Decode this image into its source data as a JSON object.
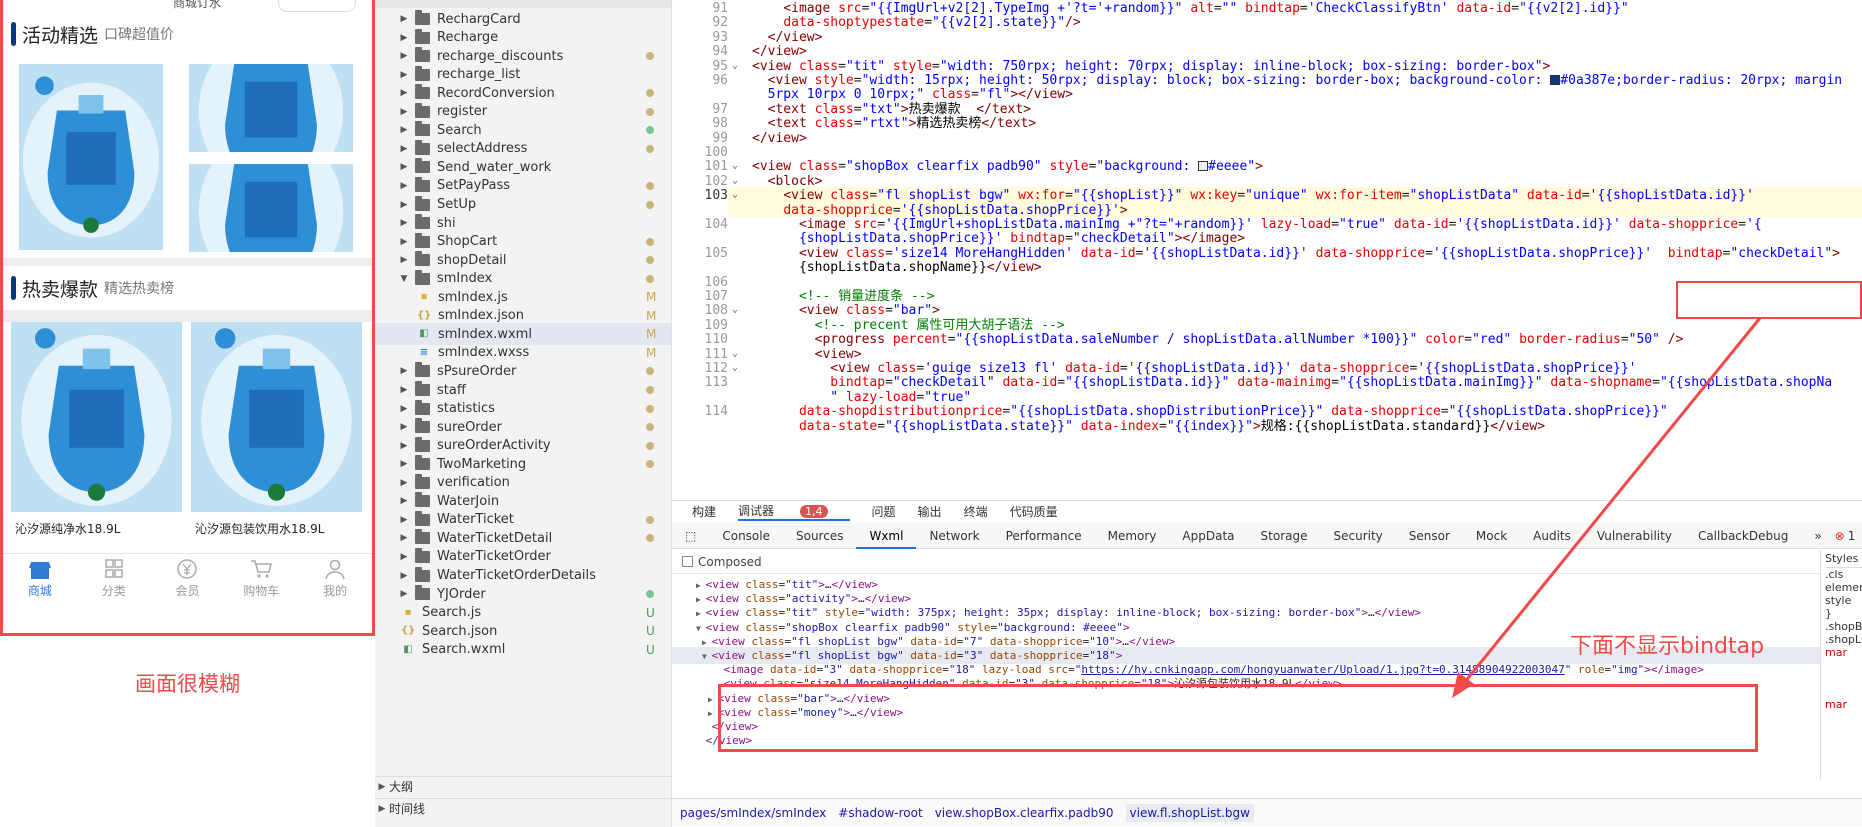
{
  "phone": {
    "top_title": "商城订水",
    "section1": {
      "title": "活动精选",
      "subtitle": "口碑超值价"
    },
    "section2": {
      "title": "热卖爆款",
      "subtitle": "精选热卖榜"
    },
    "hot_items": [
      {
        "name": "沁汐源纯净水18.9L"
      },
      {
        "name": "沁汐源包装饮用水18.9L"
      }
    ],
    "tabs": [
      "商城",
      "分类",
      "会员",
      "购物车",
      "我的"
    ],
    "active_tab": "商城",
    "accent": "#0a387e",
    "tab_active_color": "#2e7cd6"
  },
  "annotations": {
    "blurry_note": "画面很模糊",
    "bindtap_note": "下面不显示bindtap",
    "color": "#f24949"
  },
  "explorer": {
    "items": [
      {
        "name": "RechargCard",
        "kind": "folder",
        "expanded": false,
        "status": ""
      },
      {
        "name": "Recharge",
        "kind": "folder",
        "expanded": false,
        "status": ""
      },
      {
        "name": "recharge_discounts",
        "kind": "folder",
        "expanded": false,
        "status": "dot"
      },
      {
        "name": "recharge_list",
        "kind": "folder",
        "expanded": false,
        "status": ""
      },
      {
        "name": "RecordConversion",
        "kind": "folder",
        "expanded": false,
        "status": "dot"
      },
      {
        "name": "register",
        "kind": "folder",
        "expanded": false,
        "status": "dot"
      },
      {
        "name": "Search",
        "kind": "folder",
        "expanded": false,
        "status": "dot-green"
      },
      {
        "name": "selectAddress",
        "kind": "folder",
        "expanded": false,
        "status": "dot"
      },
      {
        "name": "Send_water_work",
        "kind": "folder",
        "expanded": false,
        "status": ""
      },
      {
        "name": "SetPayPass",
        "kind": "folder",
        "expanded": false,
        "status": "dot"
      },
      {
        "name": "SetUp",
        "kind": "folder",
        "expanded": false,
        "status": "dot"
      },
      {
        "name": "shi",
        "kind": "folder",
        "expanded": false,
        "status": ""
      },
      {
        "name": "ShopCart",
        "kind": "folder",
        "expanded": false,
        "status": "dot"
      },
      {
        "name": "shopDetail",
        "kind": "folder",
        "expanded": false,
        "status": "dot"
      },
      {
        "name": "smIndex",
        "kind": "folder",
        "expanded": true,
        "status": "dot"
      },
      {
        "name": "smIndex.js",
        "kind": "js",
        "status": "M",
        "indent": 1
      },
      {
        "name": "smIndex.json",
        "kind": "json",
        "status": "M",
        "indent": 1
      },
      {
        "name": "smIndex.wxml",
        "kind": "wxml",
        "status": "M",
        "indent": 1,
        "selected": true
      },
      {
        "name": "smIndex.wxss",
        "kind": "wxss",
        "status": "M",
        "indent": 1
      },
      {
        "name": "sPsureOrder",
        "kind": "folder",
        "expanded": false,
        "status": "dot"
      },
      {
        "name": "staff",
        "kind": "folder",
        "expanded": false,
        "status": "dot"
      },
      {
        "name": "statistics",
        "kind": "folder",
        "expanded": false,
        "status": "dot"
      },
      {
        "name": "sureOrder",
        "kind": "folder",
        "expanded": false,
        "status": "dot"
      },
      {
        "name": "sureOrderActivity",
        "kind": "folder",
        "expanded": false,
        "status": "dot"
      },
      {
        "name": "TwoMarketing",
        "kind": "folder",
        "expanded": false,
        "status": "dot"
      },
      {
        "name": "verification",
        "kind": "folder",
        "expanded": false,
        "status": ""
      },
      {
        "name": "WaterJoin",
        "kind": "folder",
        "expanded": false,
        "status": ""
      },
      {
        "name": "WaterTicket",
        "kind": "folder",
        "expanded": false,
        "status": "dot"
      },
      {
        "name": "WaterTicketDetail",
        "kind": "folder",
        "expanded": false,
        "status": "dot"
      },
      {
        "name": "WaterTicketOrder",
        "kind": "folder",
        "expanded": false,
        "status": ""
      },
      {
        "name": "WaterTicketOrderDetails",
        "kind": "folder",
        "expanded": false,
        "status": ""
      },
      {
        "name": "YJOrder",
        "kind": "folder",
        "expanded": false,
        "status": "dot-green"
      },
      {
        "name": "Search.js",
        "kind": "js",
        "status": "U",
        "indent": 0
      },
      {
        "name": "Search.json",
        "kind": "json",
        "status": "U",
        "indent": 0
      },
      {
        "name": "Search.wxml",
        "kind": "wxml",
        "status": "U",
        "indent": 0
      }
    ],
    "outline": "大纲",
    "timeline": "时间线"
  },
  "editor": {
    "lines": [
      {
        "n": "91",
        "html": "    <span class='tag'>&lt;image</span> <span class='at'>src</span>=<span class='st'>\"{{ImgUrl+v2[2].TypeImg +'?t='+random}}\"</span> <span class='at'>alt</span>=<span class='st'>\"\"</span> <span class='at'>bindtap</span>=<span class='st'>'CheckClassifyBtn'</span> <span class='at'>data-id</span>=<span class='st'>\"{{v2[2].id}}\"</span>"
      },
      {
        "n": "92",
        "html": "    <span class='at'>data-shoptypestate</span>=<span class='st'>\"{{v2[2].state}}\"</span><span class='tag'>/&gt;</span>"
      },
      {
        "n": "93",
        "html": "  <span class='tag'>&lt;/view&gt;</span>"
      },
      {
        "n": "94",
        "html": "<span class='tag'>&lt;/view&gt;</span>"
      },
      {
        "n": "95",
        "html": "<span class='tag'>&lt;view</span> <span class='at'>class</span>=<span class='st'>\"tit\"</span> <span class='at'>style</span>=<span class='st'>\"width: 750rpx; height: 70rpx; display: inline-block; box-sizing: border-box\"</span><span class='tag'>&gt;</span>"
      },
      {
        "n": "96",
        "html": "  <span class='tag'>&lt;view</span> <span class='at'>style</span>=<span class='st'>\"width: 15rpx; height: 50rpx; display: block; box-sizing: border-box; background-color: <span class='csw' style='background:#0a387e'></span>#0a387e;border-radius: 20rpx; margin</span>"
      },
      {
        "n": "",
        "html": "  <span class='st'>5rpx 10rpx 0 10rpx;\"</span> <span class='at'>class</span>=<span class='st'>\"fl\"</span><span class='tag'>&gt;&lt;/view&gt;</span>"
      },
      {
        "n": "97",
        "html": "  <span class='tag'>&lt;text</span> <span class='at'>class</span>=<span class='st'>\"txt\"</span><span class='tag'>&gt;</span><span class='tx'>热卖爆款  </span><span class='tag'>&lt;/text&gt;</span>"
      },
      {
        "n": "98",
        "html": "  <span class='tag'>&lt;text</span> <span class='at'>class</span>=<span class='st'>\"rtxt\"</span><span class='tag'>&gt;</span><span class='tx'>精选热卖榜</span><span class='tag'>&lt;/text&gt;</span>"
      },
      {
        "n": "99",
        "html": "<span class='tag'>&lt;/view&gt;</span>"
      },
      {
        "n": "100",
        "html": ""
      },
      {
        "n": "101",
        "html": "<span class='tag'>&lt;view</span> <span class='at'>class</span>=<span class='st'>\"shopBox clearfix padb90\"</span> <span class='at'>style</span>=<span class='st'>\"background: <span class='csw' style='background:#eeeeee'></span>#eeee\"</span><span class='tag'>&gt;</span>"
      },
      {
        "n": "102",
        "html": "  <span class='tag'>&lt;block&gt;</span>"
      },
      {
        "n": "103",
        "html": "    <span class='tag'>&lt;view</span> <span class='at'>class</span>=<span class='st'>\"fl shopList bgw\"</span> <span class='at'>wx:for</span>=<span class='st'>\"{{shopList}}\"</span> <span class='at'>wx:key</span>=<span class='st'>\"unique\"</span> <span class='at'>wx:for-item</span>=<span class='st'>\"shopListData\"</span> <span class='at'>data-id</span>=<span class='st'>'{{shopListData.id}}'</span>"
      },
      {
        "n": "",
        "html": "    <span class='at'>data-shopprice</span>=<span class='st'>'{{shopListData.shopPrice}}'</span><span class='tag'>&gt;</span>"
      },
      {
        "n": "104",
        "html": "      <span class='tag'>&lt;image</span> <span class='at'>src</span>=<span class='st'>'{{ImgUrl+shopListData.mainImg +\"?t=\"+random}}'</span> <span class='at'>lazy-load</span>=<span class='st'>\"true\"</span> <span class='at'>data-id</span>=<span class='st'>'{{shopListData.id}}'</span> <span class='at'>data-shopprice</span>=<span class='st'>'{</span>"
      },
      {
        "n": "",
        "html": "      <span class='st'>{shopListData.shopPrice}}'</span> <span class='at'>bindtap</span>=<span class='st'>\"checkDetail\"</span><span class='tag'>&gt;&lt;/image&gt;</span>"
      },
      {
        "n": "105",
        "html": "      <span class='tag'>&lt;view</span> <span class='at'>class</span>=<span class='st'>'size14 MoreHangHidden'</span> <span class='at'>data-id</span>=<span class='st'>'{{shopListData.id}}'</span> <span class='at'>data-shopprice</span>=<span class='st'>'{{shopListData.shopPrice}}'</span>  <span class='at'>bindtap</span>=<span class='st'>\"checkDetail\"</span><span class='tag'>&gt;</span>"
      },
      {
        "n": "",
        "html": "      <span class='tx'>{shopListData.shopName}}</span><span class='tag'>&lt;/view&gt;</span>"
      },
      {
        "n": "106",
        "html": ""
      },
      {
        "n": "107",
        "html": "      <span class='cm'>&lt;!-- 销量进度条 --&gt;</span>"
      },
      {
        "n": "108",
        "html": "      <span class='tag'>&lt;view</span> <span class='at'>class</span>=<span class='st'>\"bar\"</span><span class='tag'>&gt;</span>"
      },
      {
        "n": "109",
        "html": "        <span class='cm'>&lt;!-- precent 属性可用大胡子语法 --&gt;</span>"
      },
      {
        "n": "110",
        "html": "        <span class='tag'>&lt;progress</span> <span class='at'>percent</span>=<span class='st'>\"{{shopListData.saleNumber / shopListData.allNumber *100}}\"</span> <span class='at'>color</span>=<span class='st'>\"red\"</span> <span class='at'>border-radius</span>=<span class='st'>\"50\"</span> <span class='tag'>/&gt;</span>"
      },
      {
        "n": "111",
        "html": "        <span class='tag'>&lt;view&gt;</span>"
      },
      {
        "n": "112",
        "html": "          <span class='tag'>&lt;view</span> <span class='at'>class</span>=<span class='st'>'guige size13 fl'</span> <span class='at'>data-id</span>=<span class='st'>'{{shopListData.id}}'</span> <span class='at'>data-shopprice</span>=<span class='st'>'{{shopListData.shopPrice}}'</span>"
      },
      {
        "n": "113",
        "html": "          <span class='at'>bindtap</span>=<span class='st'>\"checkDetail\"</span> <span class='at'>data-id</span>=<span class='st'>\"{{shopListData.id}}\"</span> <span class='at'>data-mainimg</span>=<span class='st'>\"{{shopListData.mainImg}}\"</span> <span class='at'>data-shopname</span>=<span class='st'>\"{{shopListData.shopNa</span>"
      },
      {
        "n": "",
        "html": "          <span class='st'>\"</span> <span class='at'>lazy-load</span>=<span class='st'>\"true\"</span>"
      },
      {
        "n": "114",
        "html": "      <span class='at'>data-shopdistributionprice</span>=<span class='st'>\"{{shopListData.shopDistributionPrice}}\"</span> <span class='at'>data-shopprice</span>=<span class='st'>\"{{shopListData.shopPrice}}\"</span>"
      },
      {
        "n": "",
        "html": "      <span class='at'>data-state</span>=<span class='st'>\"{{shopListData.state}}\"</span> <span class='at'>data-index</span>=<span class='st'>\"{{index}}\"</span><span class='tag'>&gt;</span><span class='tx'>规格:{{shopListData.standard}}</span><span class='tag'>&lt;/view&gt;</span>"
      }
    ]
  },
  "devtools": {
    "top_tabs": [
      "构建",
      "调试器",
      "问题",
      "输出",
      "终端",
      "代码质量"
    ],
    "debugger_badge": "1,4",
    "panel_tabs": [
      "Console",
      "Sources",
      "Wxml",
      "Network",
      "Performance",
      "Memory",
      "AppData",
      "Storage",
      "Security",
      "Sensor",
      "Mock",
      "Audits",
      "Vulnerability",
      "CallbackDebug"
    ],
    "active_panel": "Wxml",
    "more": "»",
    "error_count": "1",
    "warn_count": "4",
    "composed_label": "Composed",
    "styles_header": "Styles",
    "styles_lines": [
      ".cls",
      "element",
      "style",
      "}",
      ".shopB",
      ".shopL",
      "  mar",
      "",
      "",
      "",
      "  mar"
    ],
    "dom_lines": [
      {
        "html": "<span class='tag'>&lt;view</span> <span class='at'>class</span>=<span class='st'>\"tit\"</span><span class='tag'>&gt;</span>…<span class='tag'>&lt;/view&gt;</span>",
        "indent": 4,
        "arrow": "▶"
      },
      {
        "html": "<span class='tag'>&lt;view</span> <span class='at'>class</span>=<span class='st'>\"activity\"</span><span class='tag'>&gt;</span>…<span class='tag'>&lt;/view&gt;</span>",
        "indent": 4,
        "arrow": "▶"
      },
      {
        "html": "<span class='tag'>&lt;view</span> <span class='at'>class</span>=<span class='st'>\"tit\"</span> <span class='at'>style</span>=<span class='st'>\"width: 375px; height: 35px; display: inline-block; box-sizing: border-box\"</span><span class='tag'>&gt;</span>…<span class='tag'>&lt;/view&gt;</span>",
        "indent": 4,
        "arrow": "▶"
      },
      {
        "html": "<span class='tag'>&lt;view</span> <span class='at'>class</span>=<span class='st'>\"shopBox clearfix padb90\"</span> <span class='at'>style</span>=<span class='st'>\"background: #eeee\"</span><span class='tag'>&gt;</span>",
        "indent": 4,
        "arrow": "▼"
      },
      {
        "html": "<span class='tag'>&lt;view</span> <span class='at'>class</span>=<span class='st'>\"fl shopList bgw\"</span> <span class='at'>data-id</span>=<span class='st'>\"7\"</span> <span class='at'>data-shopprice</span>=<span class='st'>\"10\"</span><span class='tag'>&gt;</span>…<span class='tag'>&lt;/view&gt;</span>",
        "indent": 5,
        "arrow": "▶"
      },
      {
        "html": "<span class='tag'>&lt;view</span> <span class='at'>class</span>=<span class='st'>\"fl shopList bgw\"</span> <span class='at'>data-id</span>=<span class='st'>\"3\"</span> <span class='at'>data-shopprice</span>=<span class='st'>\"18\"</span><span class='tag'>&gt;</span>",
        "indent": 5,
        "arrow": "▼",
        "selected": true
      },
      {
        "html": "<span class='tag'>&lt;image</span> <span class='at'>data-id</span>=<span class='st'>\"3\"</span> <span class='at'>data-shopprice</span>=<span class='st'>\"18\"</span> <span class='at'>lazy-load</span> <span class='at'>src</span>=<span class='st'>\"<span class='lk'>https://hy.cnkingapp.com/hongyuanwater/Upload/1.jpg?t=0.31488904922003047</span>\"</span> <span class='at'>role</span>=<span class='st'>\"img\"</span><span class='tag'>&gt;&lt;/image&gt;</span>",
        "indent": 7,
        "arrow": ""
      },
      {
        "html": "<span class='tag'>&lt;view</span> <span class='at'>class</span>=<span class='st'>\"size14 MoreHangHidden\"</span> <span class='at'>data-id</span>=<span class='st'>\"3\"</span> <span class='at'>data-shopprice</span>=<span class='st'>\"18\"</span><span class='tag'>&gt;</span>沁汐源包装饮用水18.9L<span class='tag'>&lt;/view&gt;</span>",
        "indent": 7,
        "arrow": ""
      },
      {
        "html": "<span class='tag'>&lt;view</span> <span class='at'>class</span>=<span class='st'>\"bar\"</span><span class='tag'>&gt;</span>…<span class='tag'>&lt;/view&gt;</span>",
        "indent": 6,
        "arrow": "▶"
      },
      {
        "html": "<span class='tag'>&lt;view</span> <span class='at'>class</span>=<span class='st'>\"money\"</span><span class='tag'>&gt;</span>…<span class='tag'>&lt;/view&gt;</span>",
        "indent": 6,
        "arrow": "▶"
      },
      {
        "html": "<span class='tag'>&lt;/view&gt;</span>",
        "indent": 5,
        "arrow": ""
      },
      {
        "html": "<span class='tag'>&lt;/view&gt;</span>",
        "indent": 4,
        "arrow": ""
      }
    ],
    "breadcrumbs": [
      "pages/smIndex/smIndex",
      "#shadow-root",
      "view.shopBox.clearfix.padb90",
      "view.fl.shopList.bgw"
    ]
  }
}
